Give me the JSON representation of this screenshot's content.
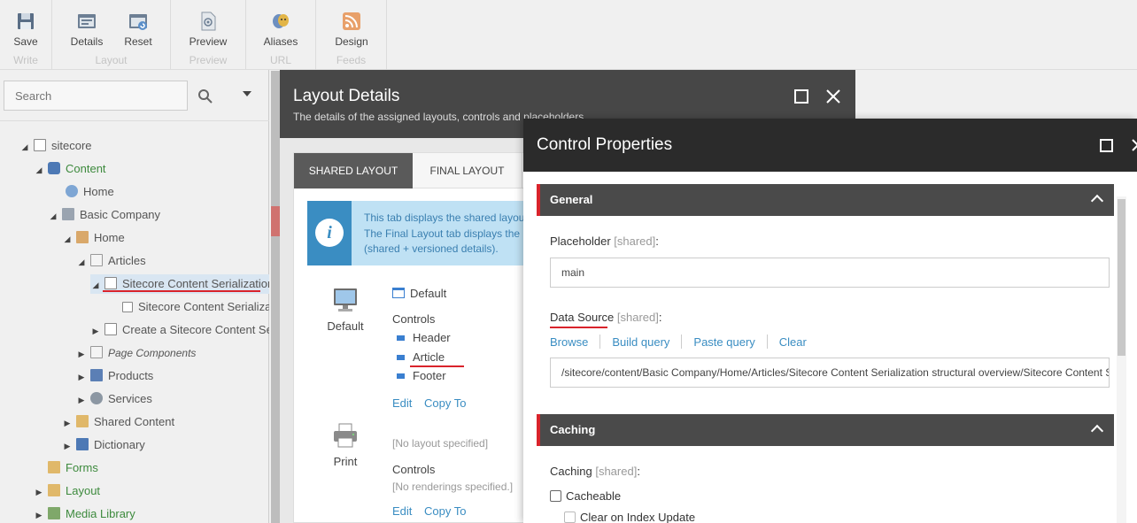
{
  "ribbon": {
    "groups": [
      {
        "name": "Write",
        "buttons": [
          {
            "label": "Save",
            "icon": "save-icon"
          }
        ]
      },
      {
        "name": "Layout",
        "buttons": [
          {
            "label": "Details",
            "icon": "details-icon"
          },
          {
            "label": "Reset",
            "icon": "reset-icon"
          }
        ]
      },
      {
        "name": "Preview",
        "buttons": [
          {
            "label": "Preview",
            "icon": "preview-icon"
          }
        ]
      },
      {
        "name": "URL",
        "buttons": [
          {
            "label": "Aliases",
            "icon": "aliases-icon"
          }
        ]
      },
      {
        "name": "Feeds",
        "buttons": [
          {
            "label": "Design",
            "icon": "rss-icon"
          }
        ]
      }
    ]
  },
  "search": {
    "placeholder": "Search"
  },
  "tree": [
    {
      "label": "sitecore",
      "icon": "page-icon",
      "expanded": true
    },
    {
      "label": "Content",
      "icon": "content-icon",
      "expanded": true,
      "color": "green"
    },
    {
      "label": "Home",
      "icon": "globe-icon"
    },
    {
      "label": "Basic Company",
      "icon": "building-icon",
      "expanded": true
    },
    {
      "label": "Home",
      "icon": "home-icon",
      "expanded": true
    },
    {
      "label": "Articles",
      "icon": "folder-icon",
      "expanded": true
    },
    {
      "label": "Sitecore Content Serialization structural overview",
      "icon": "doc-icon",
      "expanded": true,
      "selected": true
    },
    {
      "label": "Sitecore Content Serialization structural overview",
      "icon": "doc-small-icon"
    },
    {
      "label": "Create a Sitecore Content Serialization",
      "icon": "doc-icon",
      "collapsed": true
    },
    {
      "label": "Page Components",
      "icon": "folder-icon",
      "collapsed": true,
      "italic": true
    },
    {
      "label": "Products",
      "icon": "book-icon",
      "collapsed": true
    },
    {
      "label": "Services",
      "icon": "services-icon",
      "collapsed": true
    },
    {
      "label": "Shared Content",
      "icon": "shared-icon",
      "collapsed": true
    },
    {
      "label": "Dictionary",
      "icon": "dictionary-icon",
      "collapsed": true
    },
    {
      "label": "Forms",
      "icon": "forms-icon",
      "color": "green"
    },
    {
      "label": "Layout",
      "icon": "layout-icon",
      "collapsed": true,
      "color": "green"
    },
    {
      "label": "Media Library",
      "icon": "media-icon",
      "collapsed": true,
      "color": "green"
    }
  ],
  "layout_details": {
    "title": "Layout Details",
    "subtitle": "The details of the assigned layouts, controls and placeholders.",
    "tabs": [
      "SHARED LAYOUT",
      "FINAL LAYOUT"
    ],
    "info_lines": [
      "This tab displays the shared layout",
      "The Final Layout tab displays the",
      "(shared + versioned details)."
    ],
    "devices": [
      {
        "name": "Default",
        "layout": "Default",
        "controls_label": "Controls",
        "controls": [
          "Header",
          "Article",
          "Footer"
        ],
        "edit": "Edit",
        "copy_to": "Copy To"
      },
      {
        "name": "Print",
        "layout": "[No layout specified]",
        "controls_label": "Controls",
        "no_controls": "[No renderings specified.]",
        "edit": "Edit",
        "copy_to": "Copy To"
      }
    ]
  },
  "control_properties": {
    "title": "Control Properties",
    "general_label": "General",
    "placeholder_label": "Placeholder",
    "shared_tag": "[shared]",
    "placeholder_value": "main",
    "data_source_label": "Data Source",
    "data_source_links": [
      "Browse",
      "Build query",
      "Paste query",
      "Clear"
    ],
    "data_source_value": "/sitecore/content/Basic Company/Home/Articles/Sitecore Content Serialization structural overview/Sitecore Content Serialization structural overview",
    "caching_section": "Caching",
    "caching_label": "Caching",
    "cacheable": "Cacheable",
    "clear_on_index": "Clear on Index Update"
  },
  "colors": {
    "accent_red": "#d9232b",
    "link_blue": "#3a8dc2",
    "dialog_dark": "#2b2b2b",
    "tree_green": "#3d8a3d"
  }
}
